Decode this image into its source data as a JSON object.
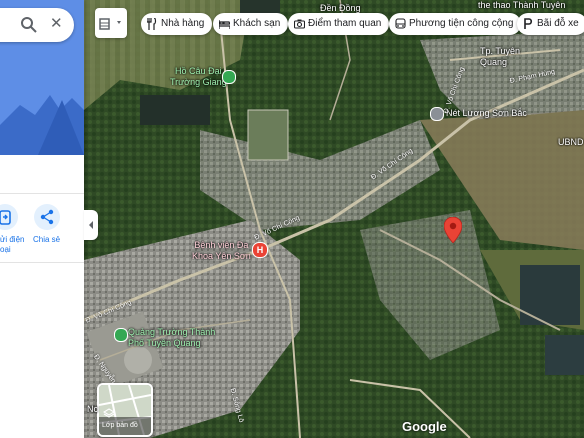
{
  "search": {
    "close_glyph": "✕"
  },
  "actions": {
    "label_1": "ửi điện\noại",
    "label_2": "Chia sẻ"
  },
  "chips": [
    {
      "label": "Nhà hàng",
      "icon": "fork-knife-icon"
    },
    {
      "label": "Khách sạn",
      "icon": "bed-icon"
    },
    {
      "label": "Điểm tham quan",
      "icon": "camera-icon"
    },
    {
      "label": "Phương tiện công cộng",
      "icon": "bus-icon"
    },
    {
      "label": "Bãi đỗ xe",
      "icon": "parking-icon"
    }
  ],
  "places": {
    "ho_cau": "Hồ Câu Đại\nTrường Giang",
    "benh_vien": "Bệnh viện Đa\nKhoa Yên Sơn",
    "quang_truong": "Quảng Trường Thành\nPhố Tuyên Quang",
    "net_luong": "Nét Lương Sơn Bắc",
    "tp_tuyen_quang": "Tp. Tuyên\nQuang",
    "top_right": "the thao Thành Tuyên",
    "ubnd": "UBND",
    "top_center": "Đền Đồng"
  },
  "roads": {
    "vo_chi_cong_1": "Đ. Võ Chí Công",
    "vo_chi_cong_2": "Đ. Võ Chí Công",
    "vo_chi_cong_3": "Đ. Võ Chí Công",
    "pham_hung": "Đ. Phạm Hùng",
    "vo_chi_cong_4": "Đ. Võ Chí Công",
    "nguyen_chi": "Đ. Nguyễn Chí",
    "song_lo": "Đ. Sông Lô",
    "no_1": "Nc"
  },
  "layers_label": "Lớp bản đồ",
  "google": "Google",
  "colors": {
    "accent": "#1a73e8",
    "pin": "#ea4335",
    "hospital": "#ea4335",
    "park_pin": "#34a853",
    "panel_hero": "#5e8ee6"
  }
}
